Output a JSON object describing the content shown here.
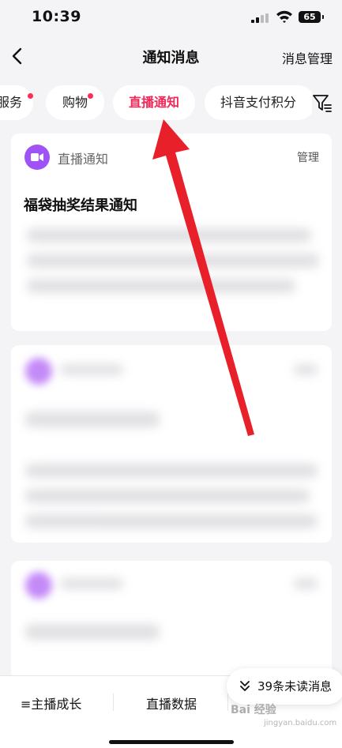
{
  "status_bar": {
    "time": "10:39",
    "battery": "65"
  },
  "nav": {
    "title": "通知消息",
    "manage": "消息管理"
  },
  "tabs": [
    {
      "label": "服务",
      "unread_dot": true
    },
    {
      "label": "购物",
      "unread_dot": true
    },
    {
      "label": "直播通知",
      "active": true
    },
    {
      "label": "抖音支付积分"
    }
  ],
  "card": {
    "source": "直播通知",
    "manage": "管理",
    "headline": "福袋抽奖结果通知"
  },
  "bottom_bar": {
    "item1": "≡主播成长",
    "item2": "直播数据"
  },
  "unread_button": {
    "label": "39条未读消息"
  },
  "watermark": {
    "brand": "Bai 经验",
    "url": "jingyan.baidu.com"
  },
  "colors": {
    "accent": "#f0295a",
    "badge": "#ff2c55",
    "avatar": "#9f52f6",
    "annotation_arrow": "#e8202a"
  }
}
